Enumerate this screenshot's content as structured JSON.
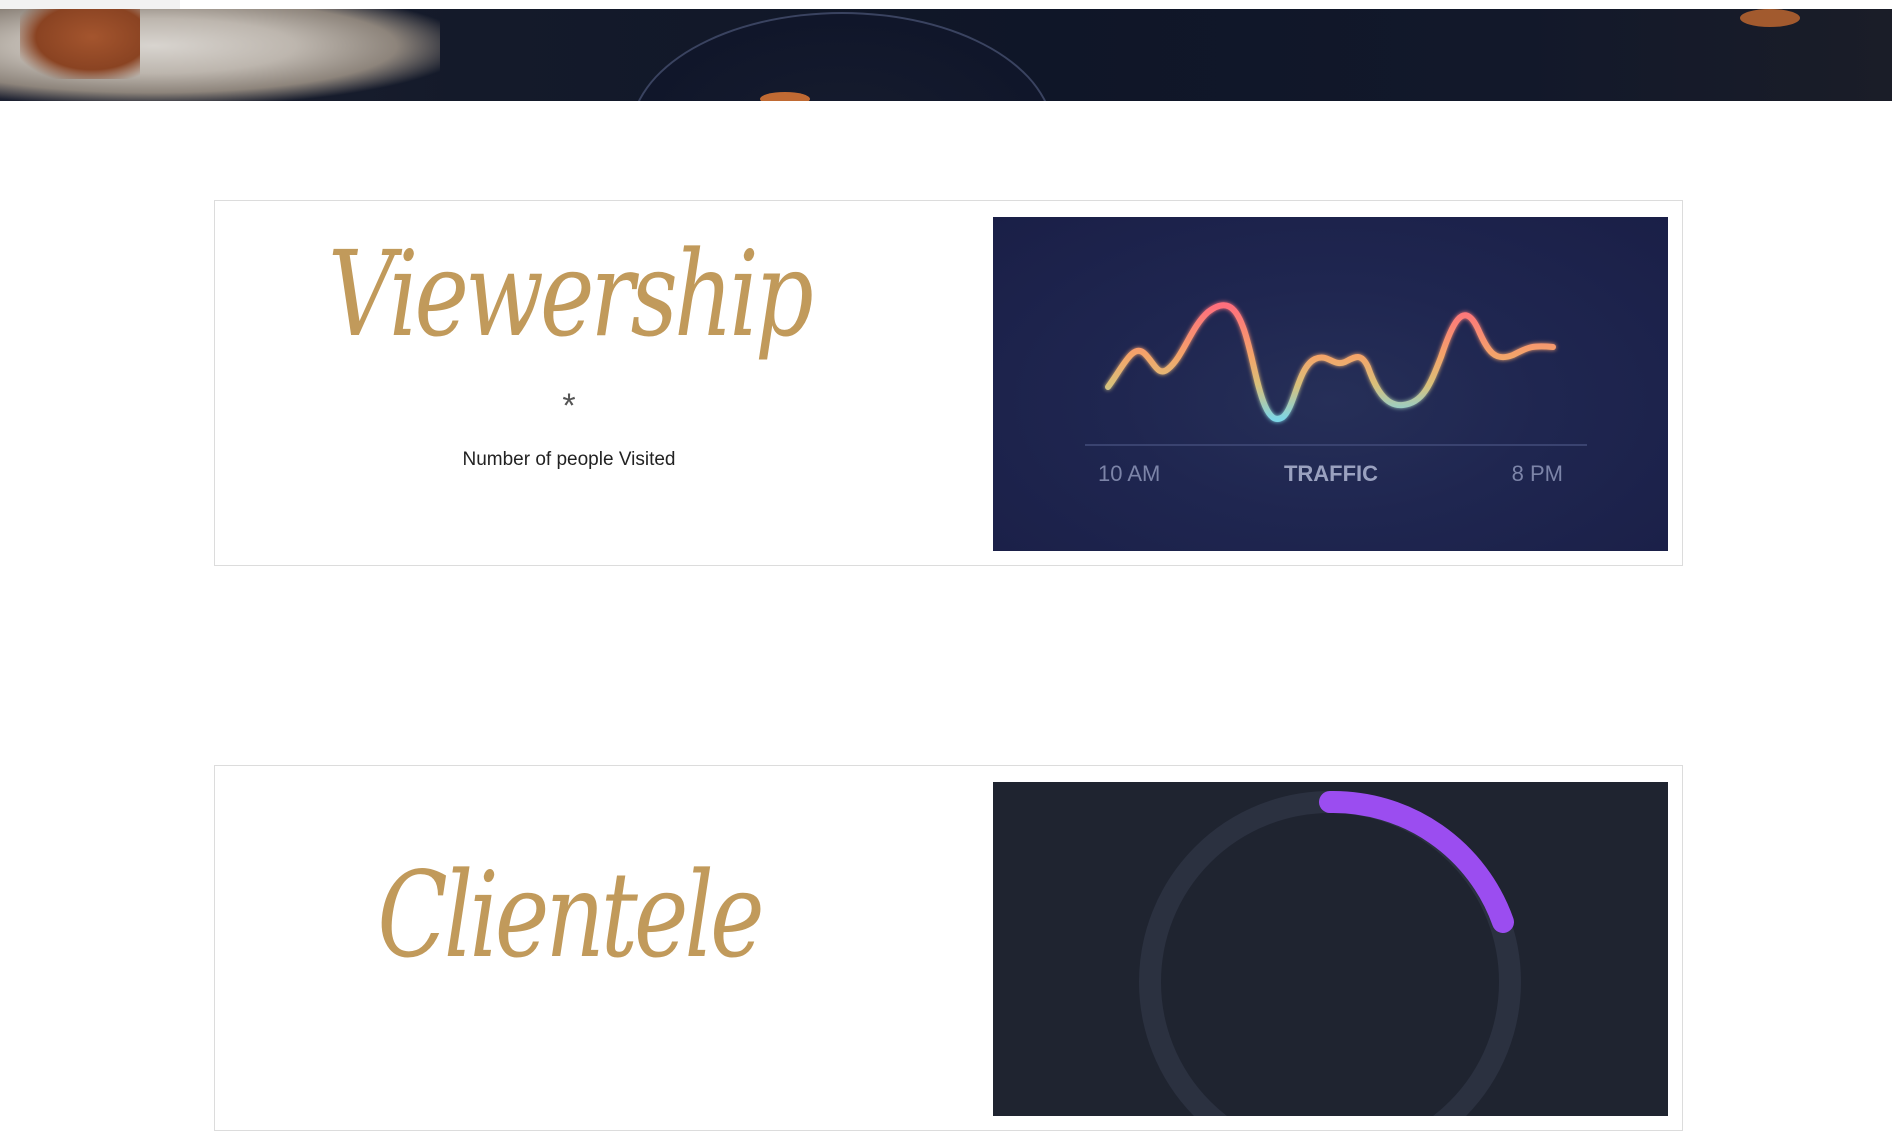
{
  "cards": [
    {
      "title": "Viewership",
      "asterisk": "*",
      "subtitle": "Number of people Visited",
      "image": {
        "kind": "traffic-chart",
        "left_label": "10 AM",
        "center_label": "TRAFFIC",
        "right_label": "8 PM",
        "line_colors": [
          "#f4c35f",
          "#ff6f7d",
          "#7dd6e6"
        ],
        "background": "#1f2650"
      }
    },
    {
      "title": "Clientele",
      "image": {
        "kind": "donut-progress",
        "track_color": "#2b3140",
        "progress_color": "#9b4df0",
        "background": "#1f2430"
      }
    }
  ]
}
